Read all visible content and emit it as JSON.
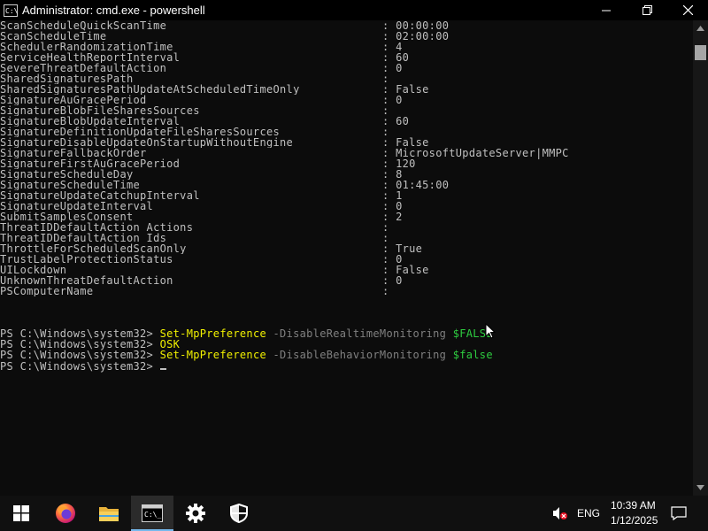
{
  "window": {
    "title": "Administrator: cmd.exe - powershell",
    "app_icon_text": "C:\\",
    "min_icon": "minimize-icon",
    "max_icon": "maximize-icon",
    "close_icon": "close-icon"
  },
  "console": {
    "properties": [
      {
        "name": "ScanScheduleQuickScanTime",
        "value": "00:00:00"
      },
      {
        "name": "ScanScheduleTime",
        "value": "02:00:00"
      },
      {
        "name": "SchedulerRandomizationTime",
        "value": "4"
      },
      {
        "name": "ServiceHealthReportInterval",
        "value": "60"
      },
      {
        "name": "SevereThreatDefaultAction",
        "value": "0"
      },
      {
        "name": "SharedSignaturesPath",
        "value": ""
      },
      {
        "name": "SharedSignaturesPathUpdateAtScheduledTimeOnly",
        "value": "False"
      },
      {
        "name": "SignatureAuGracePeriod",
        "value": "0"
      },
      {
        "name": "SignatureBlobFileSharesSources",
        "value": ""
      },
      {
        "name": "SignatureBlobUpdateInterval",
        "value": "60"
      },
      {
        "name": "SignatureDefinitionUpdateFileSharesSources",
        "value": ""
      },
      {
        "name": "SignatureDisableUpdateOnStartupWithoutEngine",
        "value": "False"
      },
      {
        "name": "SignatureFallbackOrder",
        "value": "MicrosoftUpdateServer|MMPC"
      },
      {
        "name": "SignatureFirstAuGracePeriod",
        "value": "120"
      },
      {
        "name": "SignatureScheduleDay",
        "value": "8"
      },
      {
        "name": "SignatureScheduleTime",
        "value": "01:45:00"
      },
      {
        "name": "SignatureUpdateCatchupInterval",
        "value": "1"
      },
      {
        "name": "SignatureUpdateInterval",
        "value": "0"
      },
      {
        "name": "SubmitSamplesConsent",
        "value": "2"
      },
      {
        "name": "ThreatIDDefaultAction_Actions",
        "value": ""
      },
      {
        "name": "ThreatIDDefaultAction_Ids",
        "value": ""
      },
      {
        "name": "ThrottleForScheduledScanOnly",
        "value": "True"
      },
      {
        "name": "TrustLabelProtectionStatus",
        "value": "0"
      },
      {
        "name": "UILockdown",
        "value": "False"
      },
      {
        "name": "UnknownThreatDefaultAction",
        "value": "0"
      },
      {
        "name": "PSComputerName",
        "value": ""
      }
    ],
    "separator": ": ",
    "prompt": "PS C:\\Windows\\system32> ",
    "commands": [
      {
        "cmd": "Set-MpPreference",
        "param": "-DisableRealtimeMonitoring",
        "arg": "$FALSE"
      },
      {
        "cmd": "OSK",
        "param": "",
        "arg": ""
      },
      {
        "cmd": "Set-MpPreference",
        "param": "-DisableBehaviorMonitoring",
        "arg": "$false"
      }
    ]
  },
  "scrollbar": {
    "up_icon": "scroll-up-arrow-icon",
    "down_icon": "scroll-down-arrow-icon"
  },
  "taskbar": {
    "items": [
      {
        "name": "start-button",
        "icon": "windows-logo-icon"
      },
      {
        "name": "firefox-button",
        "icon": "firefox-icon"
      },
      {
        "name": "file-explorer-button",
        "icon": "folder-icon"
      },
      {
        "name": "cmd-button",
        "icon": "console-icon"
      },
      {
        "name": "settings-button",
        "icon": "gear-icon"
      },
      {
        "name": "defender-button",
        "icon": "shield-icon"
      }
    ],
    "tray": {
      "volume_icon": "volume-muted-icon",
      "language": "ENG",
      "time": "10:39 AM",
      "date": "1/12/2025",
      "notification_icon": "action-center-icon"
    }
  },
  "colors": {
    "console_bg": "#0c0c0c",
    "console_text": "#c0c0c0",
    "cmdlet": "#f0f000",
    "param": "#808080",
    "variable": "#2ecc40",
    "taskbar_bg": "#101010",
    "accent": "#76b9ed"
  }
}
